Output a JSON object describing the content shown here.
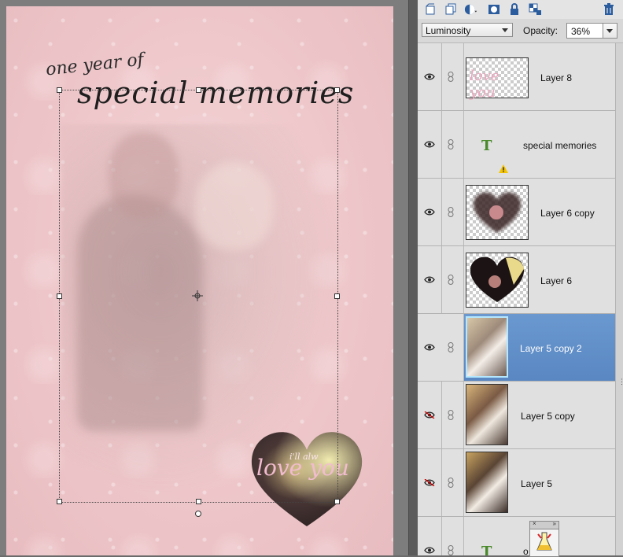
{
  "canvas": {
    "title_small": "one year of",
    "title_big": "special memories",
    "heart_text": "love you",
    "heart_small_text": "i'll alw"
  },
  "toolbar": {
    "icons": [
      "new-layer-icon",
      "duplicate-layer-icon",
      "adjustment-layer-icon",
      "layer-mask-icon",
      "lock-icon",
      "lock-transparency-icon",
      "trash-icon"
    ]
  },
  "blend": {
    "mode": "Luminosity",
    "opacity_label": "Opacity:",
    "opacity_value": "36%"
  },
  "layers": [
    {
      "name": "Layer 8",
      "visible": true,
      "selected": false,
      "kind": "image"
    },
    {
      "name": "special memories",
      "visible": true,
      "selected": false,
      "kind": "text",
      "warning": true
    },
    {
      "name": "Layer 6 copy",
      "visible": true,
      "selected": false,
      "kind": "image"
    },
    {
      "name": "Layer 6",
      "visible": true,
      "selected": false,
      "kind": "image"
    },
    {
      "name": "Layer 5 copy 2",
      "visible": true,
      "selected": true,
      "kind": "image"
    },
    {
      "name": "Layer 5 copy",
      "visible": false,
      "selected": false,
      "kind": "image"
    },
    {
      "name": "Layer 5",
      "visible": false,
      "selected": false,
      "kind": "image"
    },
    {
      "name": "one year of",
      "visible_name_partial": "o     ar of",
      "visible": true,
      "selected": false,
      "kind": "text"
    }
  ],
  "colors": {
    "selection": "#5f8dc7",
    "panel_bg": "#d6d6d6",
    "canvas_bg": "#efc9cc",
    "warning": "#f5c400",
    "text_layer_icon": "#4a8a2a"
  }
}
